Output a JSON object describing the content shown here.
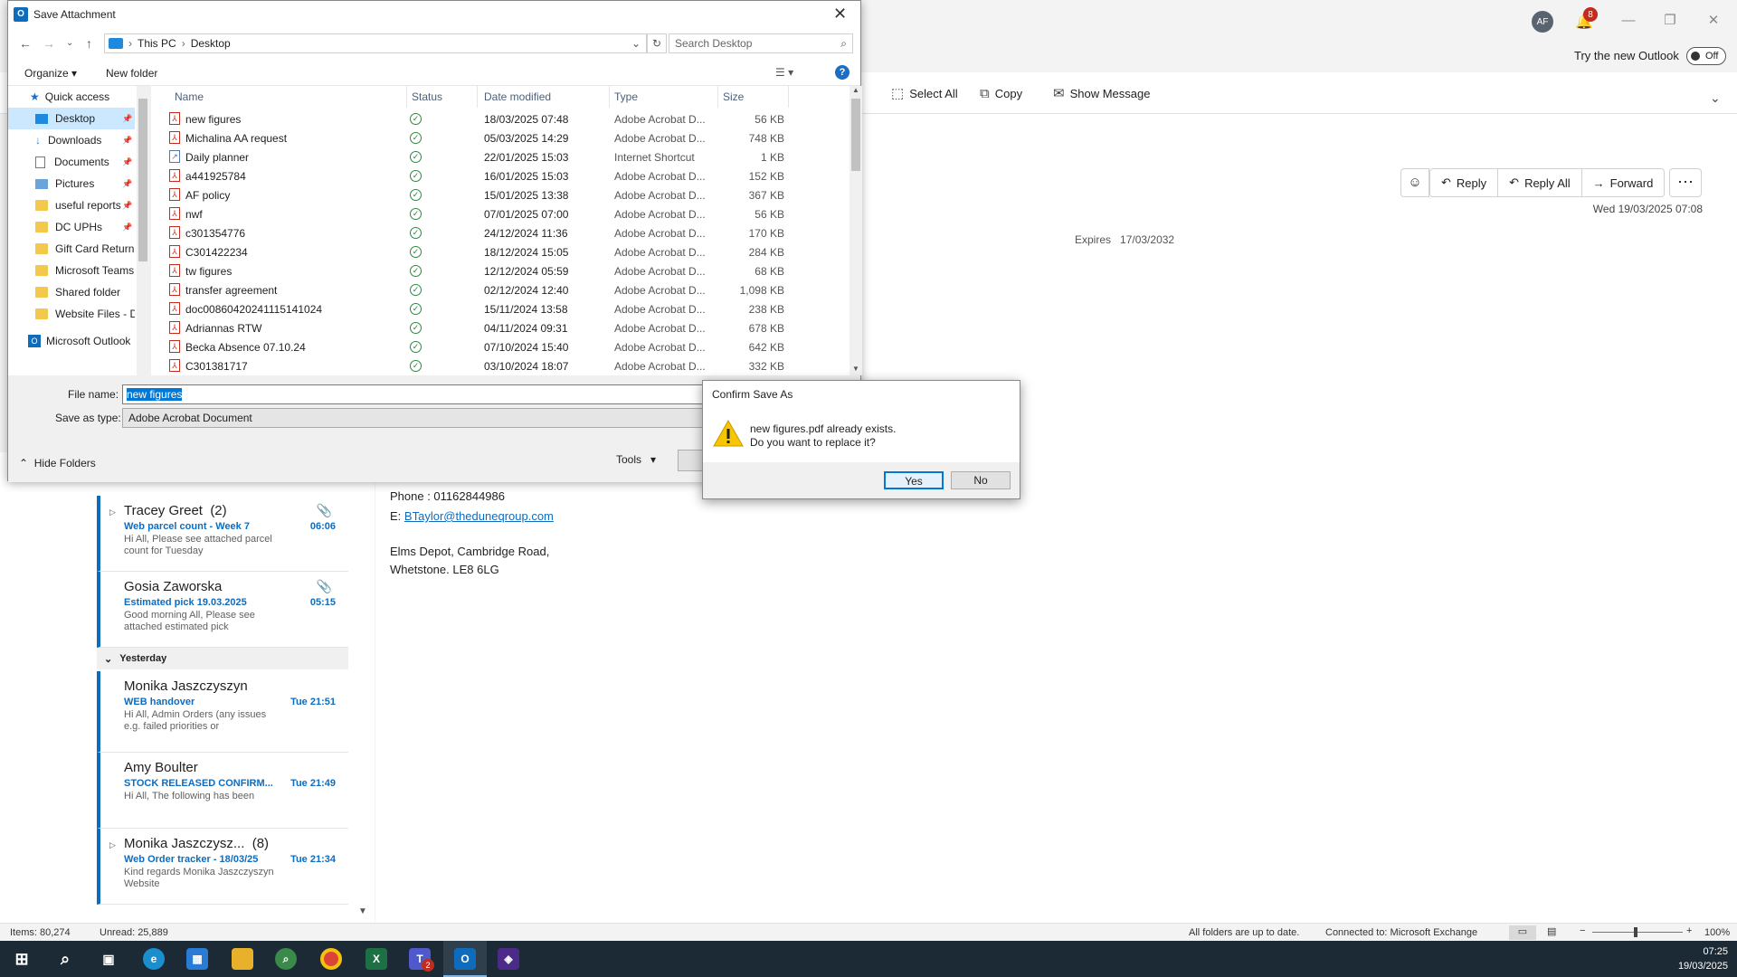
{
  "outlook": {
    "avatar": "AF",
    "notif_count": "8",
    "try_new": "Try the new Outlook",
    "toggle": "Off",
    "ribbon": [
      "Select All",
      "Copy",
      "Show Message"
    ],
    "actions": {
      "reply": "Reply",
      "reply_all": "Reply All",
      "forward": "Forward"
    },
    "msg_date": "Wed 19/03/2025 07:08",
    "expires_label": "Expires",
    "expires_date": "17/03/2032",
    "body": {
      "phone": "Phone : 01162844986",
      "email_prefix": "E:",
      "email": "BTaylor@theduneqroup.com",
      "addr1": "Elms Depot, Cambridge Road,",
      "addr2": "Whetstone. LE8 6LG"
    },
    "messages": [
      {
        "name": "Tracey Greet",
        "count": "(2)",
        "subject": "Web parcel count - Week 7",
        "time": "06:06",
        "preview": "Hi All,  Please see attached parcel count for Tuesday",
        "attach": true,
        "thread": true
      },
      {
        "name": "Gosia Zaworska",
        "count": "",
        "subject": "Estimated pick 19.03.2025",
        "time": "05:15",
        "preview": "Good morning All,  Please see attached estimated pick",
        "attach": true,
        "thread": false
      },
      {
        "name": "Monika Jaszczyszyn",
        "count": "",
        "subject": "WEB handover",
        "time": "Tue 21:51",
        "preview": "Hi All,   Admin  Orders (any issues e.g. failed priorities or",
        "attach": false,
        "thread": false
      },
      {
        "name": "Amy Boulter",
        "count": "",
        "subject": "STOCK RELEASED CONFIRM...",
        "time": "Tue 21:49",
        "preview": "Hi All, The following has been",
        "attach": false,
        "thread": false
      },
      {
        "name": "Monika Jaszczysz...",
        "count": "(8)",
        "subject": "Web Order tracker - 18/03/25",
        "time": "Tue 21:34",
        "preview": "Kind regards  Monika Jaszczyszyn  Website",
        "attach": false,
        "thread": true
      }
    ],
    "yesterday": "Yesterday",
    "status": {
      "items": "Items: 80,274",
      "unread": "Unread: 25,889",
      "sync": "All folders are up to date.",
      "connected": "Connected to: Microsoft Exchange",
      "zoom": "100%"
    }
  },
  "dialog": {
    "title": "Save Attachment",
    "path": [
      "This PC",
      "Desktop"
    ],
    "search_placeholder": "Search Desktop",
    "organize": "Organize",
    "new_folder": "New folder",
    "nav": [
      {
        "label": "Quick access",
        "type": "star"
      },
      {
        "label": "Desktop",
        "type": "desktop",
        "pinned": true,
        "selected": true
      },
      {
        "label": "Downloads",
        "type": "download",
        "pinned": true
      },
      {
        "label": "Documents",
        "type": "doc",
        "pinned": true
      },
      {
        "label": "Pictures",
        "type": "pic",
        "pinned": true
      },
      {
        "label": "useful reports",
        "type": "folder",
        "pinned": true
      },
      {
        "label": "DC UPHs",
        "type": "folder",
        "pinned": true
      },
      {
        "label": "Gift Card Return",
        "type": "folder"
      },
      {
        "label": "Microsoft Teams",
        "type": "folder"
      },
      {
        "label": "Shared folder",
        "type": "folder"
      },
      {
        "label": "Website Files - D",
        "type": "folder"
      },
      {
        "label": "Microsoft Outlook",
        "type": "outlook"
      }
    ],
    "columns": [
      "Name",
      "Status",
      "Date modified",
      "Type",
      "Size"
    ],
    "files": [
      {
        "name": "new figures",
        "date": "18/03/2025 07:48",
        "type": "Adobe Acrobat D...",
        "size": "56 KB"
      },
      {
        "name": "Michalina AA request",
        "date": "05/03/2025 14:29",
        "type": "Adobe Acrobat D...",
        "size": "748 KB"
      },
      {
        "name": "Daily planner",
        "date": "22/01/2025 15:03",
        "type": "Internet Shortcut",
        "size": "1 KB",
        "link": true
      },
      {
        "name": "a441925784",
        "date": "16/01/2025 15:03",
        "type": "Adobe Acrobat D...",
        "size": "152 KB"
      },
      {
        "name": "AF policy",
        "date": "15/01/2025 13:38",
        "type": "Adobe Acrobat D...",
        "size": "367 KB"
      },
      {
        "name": "nwf",
        "date": "07/01/2025 07:00",
        "type": "Adobe Acrobat D...",
        "size": "56 KB"
      },
      {
        "name": "c301354776",
        "date": "24/12/2024 11:36",
        "type": "Adobe Acrobat D...",
        "size": "170 KB"
      },
      {
        "name": "C301422234",
        "date": "18/12/2024 15:05",
        "type": "Adobe Acrobat D...",
        "size": "284 KB"
      },
      {
        "name": "tw figures",
        "date": "12/12/2024 05:59",
        "type": "Adobe Acrobat D...",
        "size": "68 KB"
      },
      {
        "name": "transfer agreement",
        "date": "02/12/2024 12:40",
        "type": "Adobe Acrobat D...",
        "size": "1,098 KB"
      },
      {
        "name": "doc00860420241115141024",
        "date": "15/11/2024 13:58",
        "type": "Adobe Acrobat D...",
        "size": "238 KB"
      },
      {
        "name": "Adriannas RTW",
        "date": "04/11/2024 09:31",
        "type": "Adobe Acrobat D...",
        "size": "678 KB"
      },
      {
        "name": "Becka Absence 07.10.24",
        "date": "07/10/2024 15:40",
        "type": "Adobe Acrobat D...",
        "size": "642 KB"
      },
      {
        "name": "C301381717",
        "date": "03/10/2024 18:07",
        "type": "Adobe Acrobat D...",
        "size": "332 KB"
      }
    ],
    "file_name_label": "File name:",
    "file_name": "new figures",
    "save_type_label": "Save as type:",
    "save_type": "Adobe Acrobat Document",
    "hide_folders": "Hide Folders",
    "tools": "Tools"
  },
  "confirm": {
    "title": "Confirm Save As",
    "line1": "new figures.pdf already exists.",
    "line2": "Do you want to replace it?",
    "yes": "Yes",
    "no": "No"
  },
  "taskbar": {
    "time": "07:25",
    "date": "19/03/2025",
    "teams_badge": "2"
  }
}
